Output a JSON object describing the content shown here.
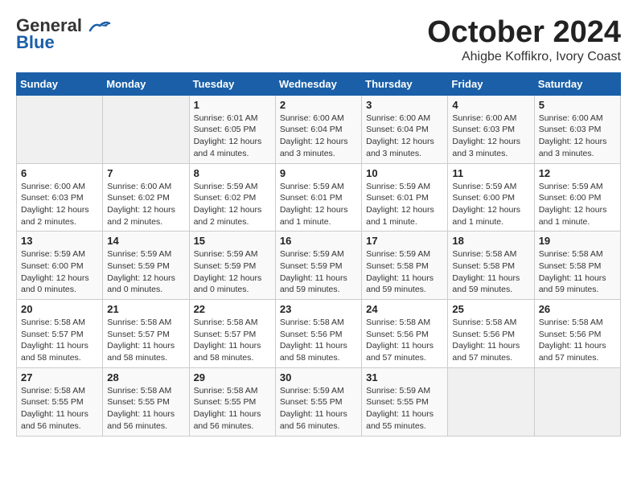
{
  "header": {
    "logo_line1": "General",
    "logo_line2": "Blue",
    "month": "October 2024",
    "location": "Ahigbe Koffikro, Ivory Coast"
  },
  "weekdays": [
    "Sunday",
    "Monday",
    "Tuesday",
    "Wednesday",
    "Thursday",
    "Friday",
    "Saturday"
  ],
  "weeks": [
    [
      {
        "day": "",
        "info": ""
      },
      {
        "day": "",
        "info": ""
      },
      {
        "day": "1",
        "info": "Sunrise: 6:01 AM\nSunset: 6:05 PM\nDaylight: 12 hours and 4 minutes."
      },
      {
        "day": "2",
        "info": "Sunrise: 6:00 AM\nSunset: 6:04 PM\nDaylight: 12 hours and 3 minutes."
      },
      {
        "day": "3",
        "info": "Sunrise: 6:00 AM\nSunset: 6:04 PM\nDaylight: 12 hours and 3 minutes."
      },
      {
        "day": "4",
        "info": "Sunrise: 6:00 AM\nSunset: 6:03 PM\nDaylight: 12 hours and 3 minutes."
      },
      {
        "day": "5",
        "info": "Sunrise: 6:00 AM\nSunset: 6:03 PM\nDaylight: 12 hours and 3 minutes."
      }
    ],
    [
      {
        "day": "6",
        "info": "Sunrise: 6:00 AM\nSunset: 6:03 PM\nDaylight: 12 hours and 2 minutes."
      },
      {
        "day": "7",
        "info": "Sunrise: 6:00 AM\nSunset: 6:02 PM\nDaylight: 12 hours and 2 minutes."
      },
      {
        "day": "8",
        "info": "Sunrise: 5:59 AM\nSunset: 6:02 PM\nDaylight: 12 hours and 2 minutes."
      },
      {
        "day": "9",
        "info": "Sunrise: 5:59 AM\nSunset: 6:01 PM\nDaylight: 12 hours and 1 minute."
      },
      {
        "day": "10",
        "info": "Sunrise: 5:59 AM\nSunset: 6:01 PM\nDaylight: 12 hours and 1 minute."
      },
      {
        "day": "11",
        "info": "Sunrise: 5:59 AM\nSunset: 6:00 PM\nDaylight: 12 hours and 1 minute."
      },
      {
        "day": "12",
        "info": "Sunrise: 5:59 AM\nSunset: 6:00 PM\nDaylight: 12 hours and 1 minute."
      }
    ],
    [
      {
        "day": "13",
        "info": "Sunrise: 5:59 AM\nSunset: 6:00 PM\nDaylight: 12 hours and 0 minutes."
      },
      {
        "day": "14",
        "info": "Sunrise: 5:59 AM\nSunset: 5:59 PM\nDaylight: 12 hours and 0 minutes."
      },
      {
        "day": "15",
        "info": "Sunrise: 5:59 AM\nSunset: 5:59 PM\nDaylight: 12 hours and 0 minutes."
      },
      {
        "day": "16",
        "info": "Sunrise: 5:59 AM\nSunset: 5:59 PM\nDaylight: 11 hours and 59 minutes."
      },
      {
        "day": "17",
        "info": "Sunrise: 5:59 AM\nSunset: 5:58 PM\nDaylight: 11 hours and 59 minutes."
      },
      {
        "day": "18",
        "info": "Sunrise: 5:58 AM\nSunset: 5:58 PM\nDaylight: 11 hours and 59 minutes."
      },
      {
        "day": "19",
        "info": "Sunrise: 5:58 AM\nSunset: 5:58 PM\nDaylight: 11 hours and 59 minutes."
      }
    ],
    [
      {
        "day": "20",
        "info": "Sunrise: 5:58 AM\nSunset: 5:57 PM\nDaylight: 11 hours and 58 minutes."
      },
      {
        "day": "21",
        "info": "Sunrise: 5:58 AM\nSunset: 5:57 PM\nDaylight: 11 hours and 58 minutes."
      },
      {
        "day": "22",
        "info": "Sunrise: 5:58 AM\nSunset: 5:57 PM\nDaylight: 11 hours and 58 minutes."
      },
      {
        "day": "23",
        "info": "Sunrise: 5:58 AM\nSunset: 5:56 PM\nDaylight: 11 hours and 58 minutes."
      },
      {
        "day": "24",
        "info": "Sunrise: 5:58 AM\nSunset: 5:56 PM\nDaylight: 11 hours and 57 minutes."
      },
      {
        "day": "25",
        "info": "Sunrise: 5:58 AM\nSunset: 5:56 PM\nDaylight: 11 hours and 57 minutes."
      },
      {
        "day": "26",
        "info": "Sunrise: 5:58 AM\nSunset: 5:56 PM\nDaylight: 11 hours and 57 minutes."
      }
    ],
    [
      {
        "day": "27",
        "info": "Sunrise: 5:58 AM\nSunset: 5:55 PM\nDaylight: 11 hours and 56 minutes."
      },
      {
        "day": "28",
        "info": "Sunrise: 5:58 AM\nSunset: 5:55 PM\nDaylight: 11 hours and 56 minutes."
      },
      {
        "day": "29",
        "info": "Sunrise: 5:58 AM\nSunset: 5:55 PM\nDaylight: 11 hours and 56 minutes."
      },
      {
        "day": "30",
        "info": "Sunrise: 5:59 AM\nSunset: 5:55 PM\nDaylight: 11 hours and 56 minutes."
      },
      {
        "day": "31",
        "info": "Sunrise: 5:59 AM\nSunset: 5:55 PM\nDaylight: 11 hours and 55 minutes."
      },
      {
        "day": "",
        "info": ""
      },
      {
        "day": "",
        "info": ""
      }
    ]
  ]
}
